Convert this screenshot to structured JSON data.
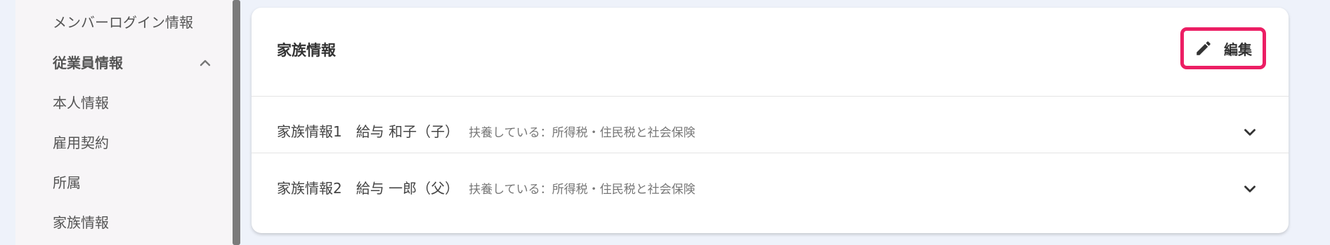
{
  "sidebar": {
    "items": [
      {
        "label": "メンバーログイン情報"
      },
      {
        "label": "従業員情報"
      },
      {
        "label": "本人情報"
      },
      {
        "label": "雇用契約"
      },
      {
        "label": "所属"
      },
      {
        "label": "家族情報"
      }
    ]
  },
  "card": {
    "title": "家族情報",
    "edit_label": "編集",
    "rows": [
      {
        "heading": "家族情報1",
        "name": "給与 和子（子）",
        "status": "扶養している：所得税・住民税と社会保険"
      },
      {
        "heading": "家族情報2",
        "name": "給与 一郎（父）",
        "status": "扶養している：所得税・住民税と社会保険"
      }
    ]
  },
  "icons": {
    "edit": "pencil-icon",
    "expand": "chevron-down-icon",
    "collapse": "chevron-up-icon"
  },
  "colors": {
    "highlight_border": "#ec1e64",
    "page_background": "#eef2fa",
    "sidebar_background": "#f7f5f7"
  }
}
